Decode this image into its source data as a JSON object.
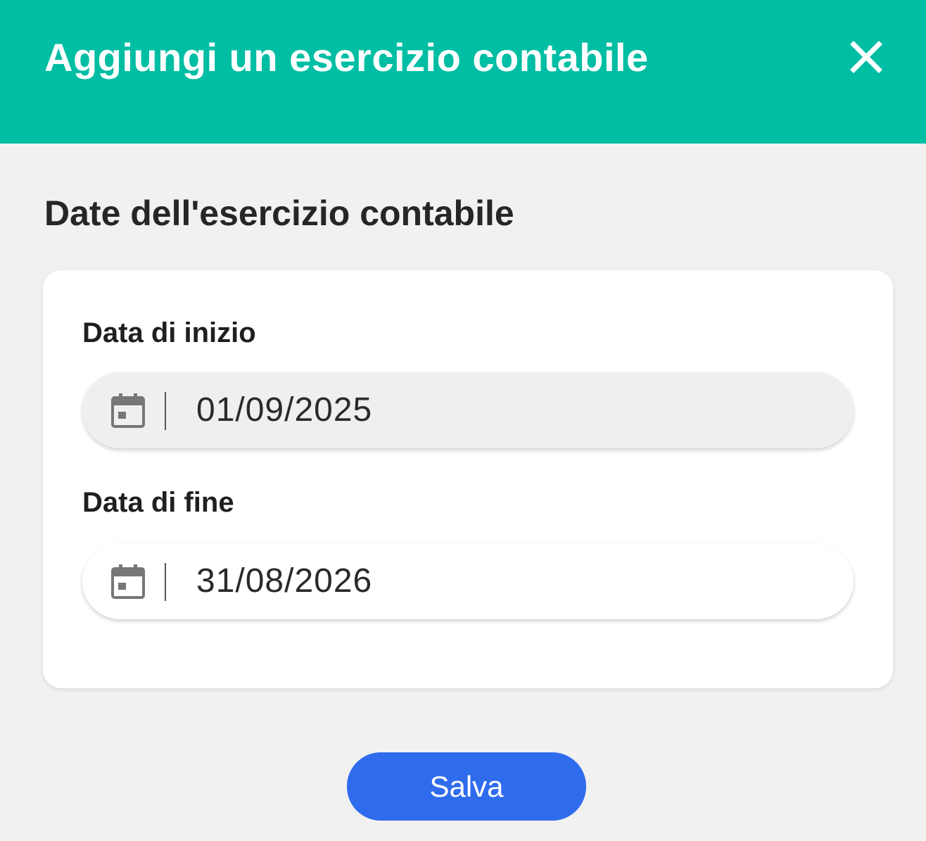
{
  "dialog": {
    "title": "Aggiungi un esercizio contabile",
    "close_icon": "close-icon",
    "header_color": "#00bea3"
  },
  "section": {
    "title": "Date dell'esercizio contabile"
  },
  "fields": {
    "start": {
      "label": "Data di inizio",
      "value": "01/09/2025",
      "icon": "calendar-icon",
      "focused": true
    },
    "end": {
      "label": "Data di fine",
      "value": "31/08/2026",
      "icon": "calendar-icon",
      "focused": false
    }
  },
  "actions": {
    "save_label": "Salva",
    "save_color": "#2f6ced"
  }
}
